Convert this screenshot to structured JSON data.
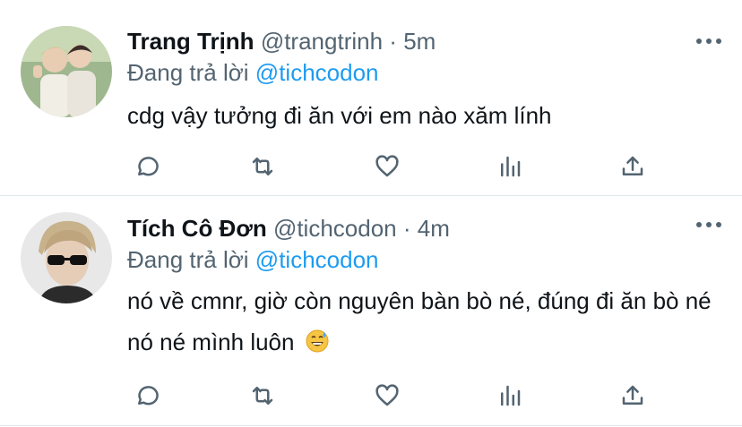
{
  "colors": {
    "text": "#0f1419",
    "secondary": "#536471",
    "accent": "#1d9bf0",
    "divider": "#e1e8ed"
  },
  "tweets": [
    {
      "name": "Trang Trịnh",
      "handle": "@trangtrinh",
      "separator": "·",
      "time": "5m",
      "replying_prefix": "Đang trả lời",
      "replying_to": "@tichcodon",
      "text": "cdg vậy tưởng đi ăn với em nào xăm lính",
      "emoji": ""
    },
    {
      "name": "Tích Cô Đơn",
      "handle": "@tichcodon",
      "separator": "·",
      "time": "4m",
      "replying_prefix": "Đang trả lời",
      "replying_to": "@tichcodon",
      "text": "nó về cmnr, giờ còn nguyên bàn bò né, đúng đi ăn bò né nó né mình luôn",
      "emoji": "grinning-sweat-emoji"
    }
  ],
  "action_icons": [
    "reply-icon",
    "retweet-icon",
    "like-icon",
    "stats-icon",
    "share-icon"
  ]
}
